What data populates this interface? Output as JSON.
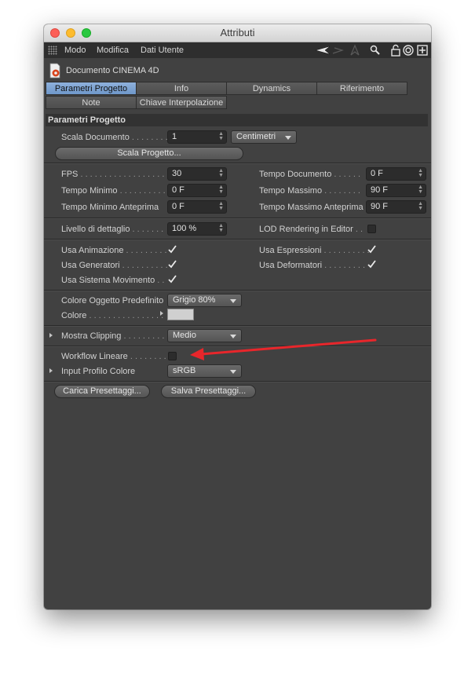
{
  "window": {
    "title": "Attributi"
  },
  "menubar": {
    "items": [
      "Modo",
      "Modifica",
      "Dati Utente"
    ]
  },
  "document": {
    "title": "Documento CINEMA 4D"
  },
  "tabs": {
    "row1": [
      "Parametri Progetto",
      "Info",
      "Dynamics",
      "Riferimento"
    ],
    "row2": [
      "Note",
      "Chiave Interpolazione"
    ],
    "active": "Parametri Progetto"
  },
  "section": {
    "title": "Parametri Progetto"
  },
  "scala": {
    "label": "Scala Documento",
    "value": "1",
    "unit": "Centimetri",
    "button": "Scala Progetto..."
  },
  "time": {
    "fps_label": "FPS",
    "fps_value": "30",
    "tempo_doc_label": "Tempo Documento",
    "tempo_doc_value": "0 F",
    "tempo_min_label": "Tempo Minimo",
    "tempo_min_value": "0 F",
    "tempo_max_label": "Tempo Massimo",
    "tempo_max_value": "90 F",
    "tempo_min_prev_label": "Tempo Minimo Anteprima",
    "tempo_min_prev_value": "0 F",
    "tempo_max_prev_label": "Tempo Massimo Anteprima",
    "tempo_max_prev_value": "90 F"
  },
  "detail": {
    "label": "Livello di dettaglio",
    "value": "100 %",
    "lod_label": "LOD Rendering in Editor",
    "lod_checked": false
  },
  "use": {
    "animazione": "Usa Animazione",
    "espressioni": "Usa Espressioni",
    "generatori": "Usa Generatori",
    "deformatori": "Usa Deformatori",
    "movimento": "Usa Sistema Movimento",
    "animazione_checked": true,
    "espressioni_checked": true,
    "generatori_checked": true,
    "deformatori_checked": true,
    "movimento_checked": true
  },
  "color": {
    "default_label": "Colore Oggetto Predefinito",
    "default_value": "Grigio 80%",
    "color_label": "Colore",
    "swatch": "#d0d0d0"
  },
  "clipping": {
    "label": "Mostra Clipping",
    "value": "Medio"
  },
  "workflow": {
    "label": "Workflow Lineare",
    "checked": false
  },
  "profile": {
    "label": "Input Profilo Colore",
    "value": "sRGB"
  },
  "presets": {
    "load": "Carica Presettaggi...",
    "save": "Salva Presettaggi..."
  },
  "annotation": {
    "arrow_color": "#e8262b"
  },
  "colors": {
    "panel": "#414141",
    "active_tab": "#7ba0cf",
    "section_bar": "#323232"
  }
}
